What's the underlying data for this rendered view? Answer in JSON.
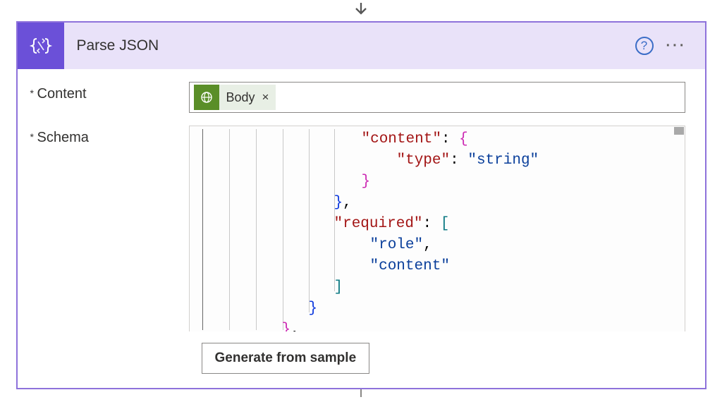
{
  "header": {
    "title": "Parse JSON"
  },
  "fields": {
    "content_label": "Content",
    "schema_label": "Schema"
  },
  "content_tag": {
    "label": "Body",
    "close": "×",
    "icon_name": "globe-icon"
  },
  "schema_code": {
    "lines": [
      {
        "indent": 244,
        "segments": [
          {
            "t": "\"content\"",
            "c": "key"
          },
          {
            "t": ": ",
            "c": "punc"
          },
          {
            "t": "{",
            "c": "brace-pink"
          }
        ]
      },
      {
        "indent": 294,
        "segments": [
          {
            "t": "\"type\"",
            "c": "key"
          },
          {
            "t": ": ",
            "c": "punc"
          },
          {
            "t": "\"string\"",
            "c": "string"
          }
        ]
      },
      {
        "indent": 244,
        "segments": [
          {
            "t": "}",
            "c": "brace-pink"
          }
        ]
      },
      {
        "indent": 205,
        "segments": [
          {
            "t": "}",
            "c": "brace-blue"
          },
          {
            "t": ",",
            "c": "punc"
          }
        ]
      },
      {
        "indent": 205,
        "segments": [
          {
            "t": "\"required\"",
            "c": "key"
          },
          {
            "t": ": ",
            "c": "punc"
          },
          {
            "t": "[",
            "c": "bracket-teal"
          }
        ]
      },
      {
        "indent": 256,
        "segments": [
          {
            "t": "\"role\"",
            "c": "string"
          },
          {
            "t": ",",
            "c": "punc"
          }
        ]
      },
      {
        "indent": 256,
        "segments": [
          {
            "t": "\"content\"",
            "c": "string"
          }
        ]
      },
      {
        "indent": 205,
        "segments": [
          {
            "t": "]",
            "c": "bracket-teal"
          }
        ]
      },
      {
        "indent": 169,
        "segments": [
          {
            "t": "}",
            "c": "brace-blue"
          }
        ]
      },
      {
        "indent": 131,
        "segments": [
          {
            "t": "}",
            "c": "brace-pink"
          },
          {
            "t": ",",
            "c": "punc"
          }
        ]
      }
    ]
  },
  "buttons": {
    "generate": "Generate from sample"
  }
}
